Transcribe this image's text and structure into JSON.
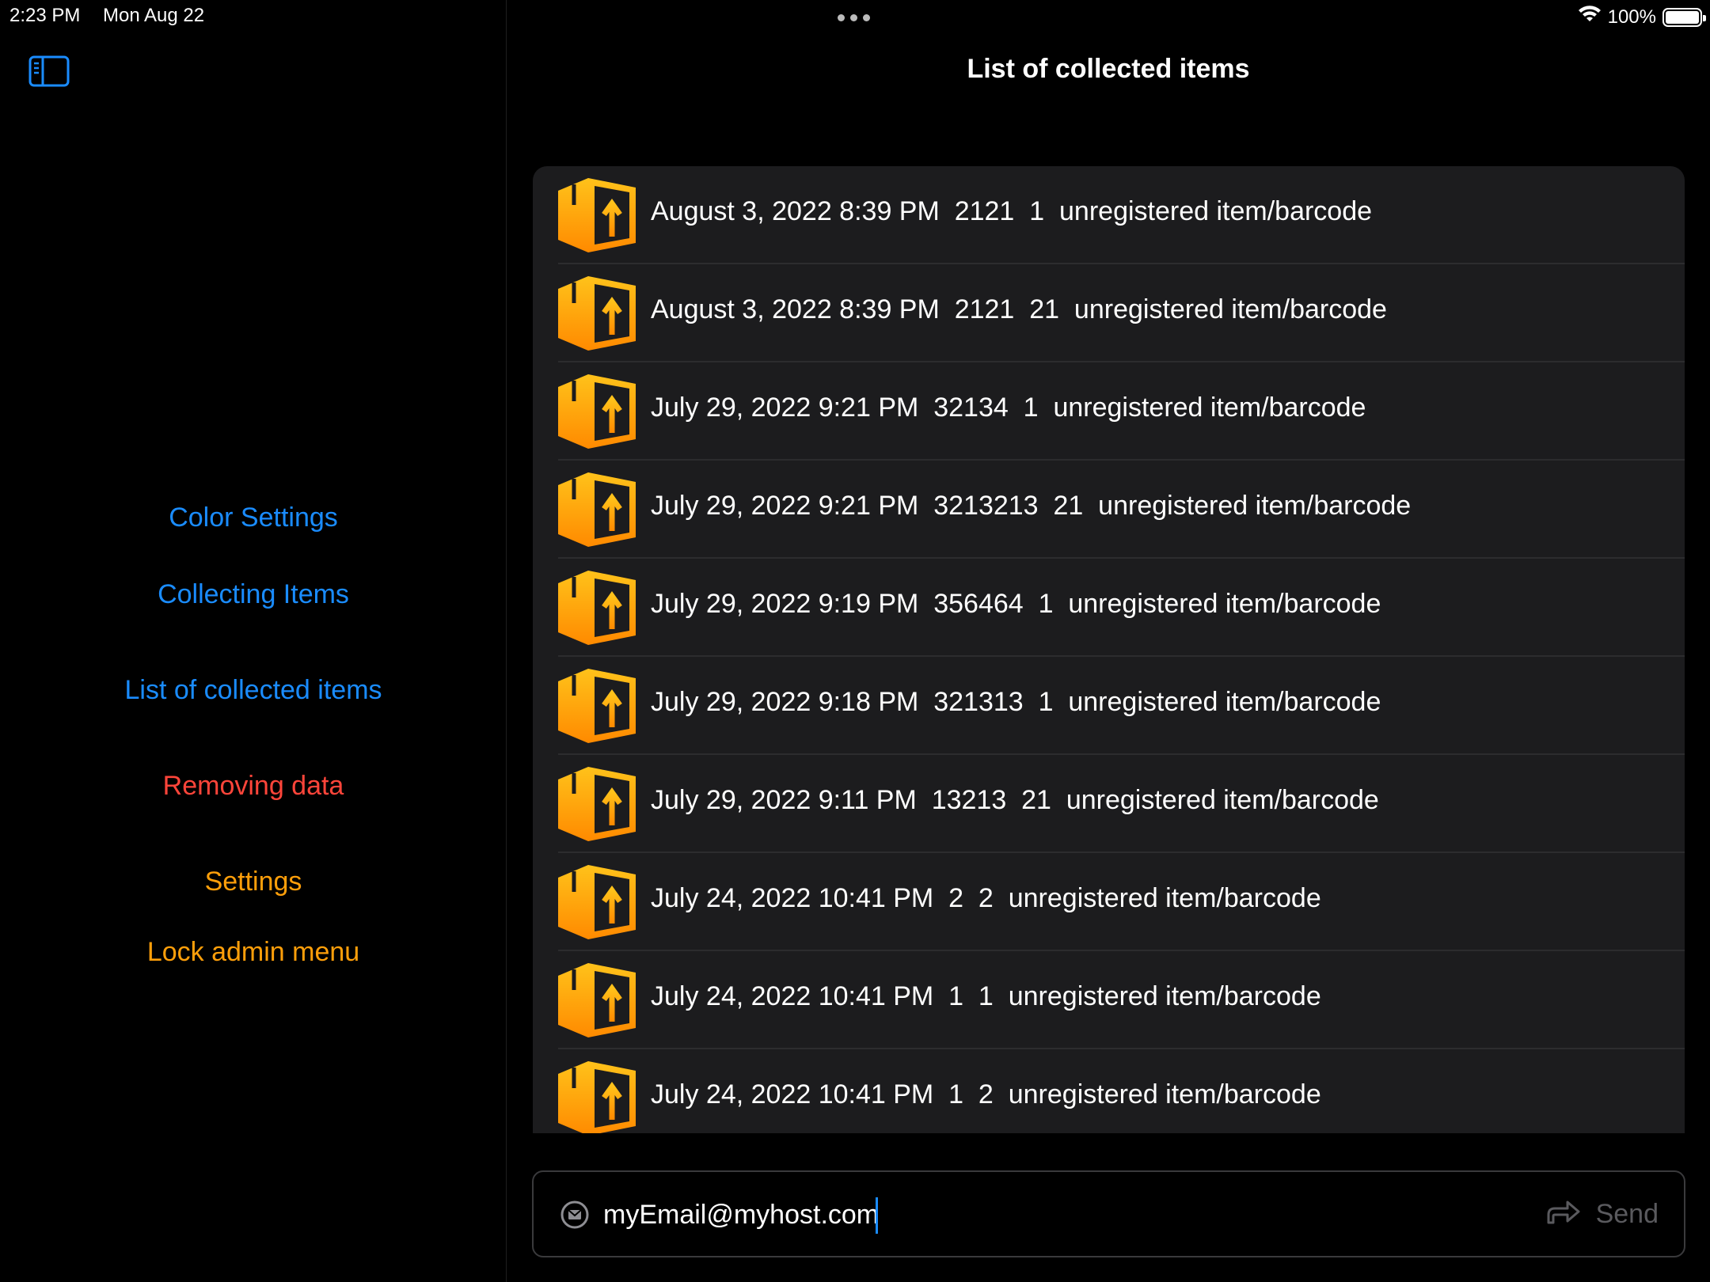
{
  "status_bar": {
    "time": "2:23 PM",
    "date": "Mon Aug 22",
    "battery": "100%",
    "icons": [
      "wifi-icon",
      "battery-icon"
    ]
  },
  "sidebar": {
    "toggle_icon": "sidebar-toggle-icon",
    "items": [
      {
        "label": "Color Settings",
        "color": "#1a8cff"
      },
      {
        "label": "Collecting Items",
        "color": "#1a8cff"
      },
      {
        "label": "List of collected items",
        "color": "#1a8cff"
      },
      {
        "label": "Removing data",
        "color": "#ff453a"
      },
      {
        "label": "Settings",
        "color": "#ff9f0a"
      },
      {
        "label": "Lock admin menu",
        "color": "#ff9f0a"
      }
    ]
  },
  "main": {
    "title": "List of collected items",
    "row_icon": "package-box-icon",
    "rows": [
      {
        "text": "August 3, 2022 8:39 PM  2121  1  unregistered item/barcode"
      },
      {
        "text": "August 3, 2022 8:39 PM  2121  21  unregistered item/barcode"
      },
      {
        "text": "July 29, 2022 9:21 PM  32134  1  unregistered item/barcode"
      },
      {
        "text": "July 29, 2022 9:21 PM  3213213  21  unregistered item/barcode"
      },
      {
        "text": "July 29, 2022 9:19 PM  356464  1  unregistered item/barcode"
      },
      {
        "text": "July 29, 2022 9:18 PM  321313  1  unregistered item/barcode"
      },
      {
        "text": "July 29, 2022 9:11 PM  13213  21  unregistered item/barcode"
      },
      {
        "text": "July 24, 2022 10:41 PM  2  2  unregistered item/barcode"
      },
      {
        "text": "July 24, 2022 10:41 PM  1  1  unregistered item/barcode"
      },
      {
        "text": "July 24, 2022 10:41 PM  1  2  unregistered item/barcode"
      }
    ]
  },
  "email_bar": {
    "icon": "envelope-icon",
    "value": "myEmail@myhost.com",
    "send_icon": "share-arrow-icon",
    "send_label": "Send"
  },
  "colors": {
    "accent_blue": "#1a8cff",
    "danger_red": "#ff453a",
    "orange": "#ff9f0a",
    "list_bg": "#1c1c1e"
  }
}
